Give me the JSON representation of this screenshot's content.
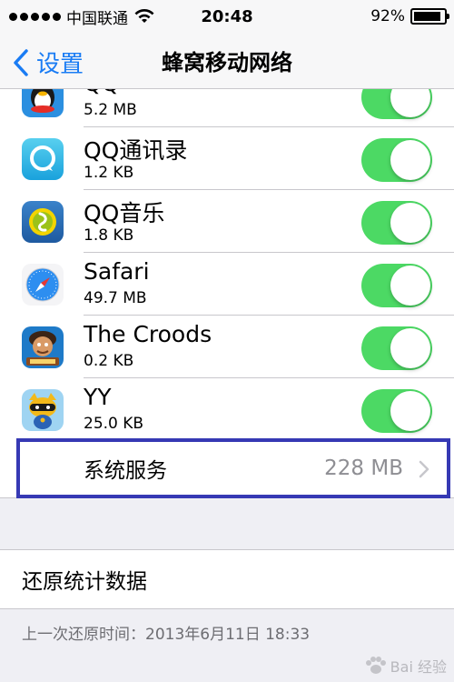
{
  "status_bar": {
    "carrier": "中国联通",
    "time": "20:48",
    "battery_text": "92%",
    "battery_level": 0.92
  },
  "nav": {
    "back_label": "设置",
    "title": "蜂窝移动网络"
  },
  "apps": [
    {
      "name": "QQ",
      "size": "5.2 MB",
      "enabled": true,
      "icon": "qq-penguin-icon"
    },
    {
      "name": "QQ通讯录",
      "size": "1.2 KB",
      "enabled": true,
      "icon": "qq-contacts-icon"
    },
    {
      "name": "QQ音乐",
      "size": "1.8 KB",
      "enabled": true,
      "icon": "qq-music-icon"
    },
    {
      "name": "Safari",
      "size": "49.7 MB",
      "enabled": true,
      "icon": "safari-compass-icon"
    },
    {
      "name": "The Croods",
      "size": "0.2 KB",
      "enabled": true,
      "icon": "croods-icon"
    },
    {
      "name": "YY",
      "size": "25.0 KB",
      "enabled": true,
      "icon": "yy-icon"
    }
  ],
  "system_services": {
    "label": "系统服务",
    "value": "228 MB"
  },
  "reset": {
    "label": "还原统计数据"
  },
  "footer": {
    "last_reset": "上一次还原时间：2013年6月11日 18:33"
  },
  "watermark": {
    "text": "Bai 经验"
  },
  "colors": {
    "accent": "#1a7cf4",
    "toggle_on": "#4cd964",
    "highlight_border": "#3639b4"
  }
}
